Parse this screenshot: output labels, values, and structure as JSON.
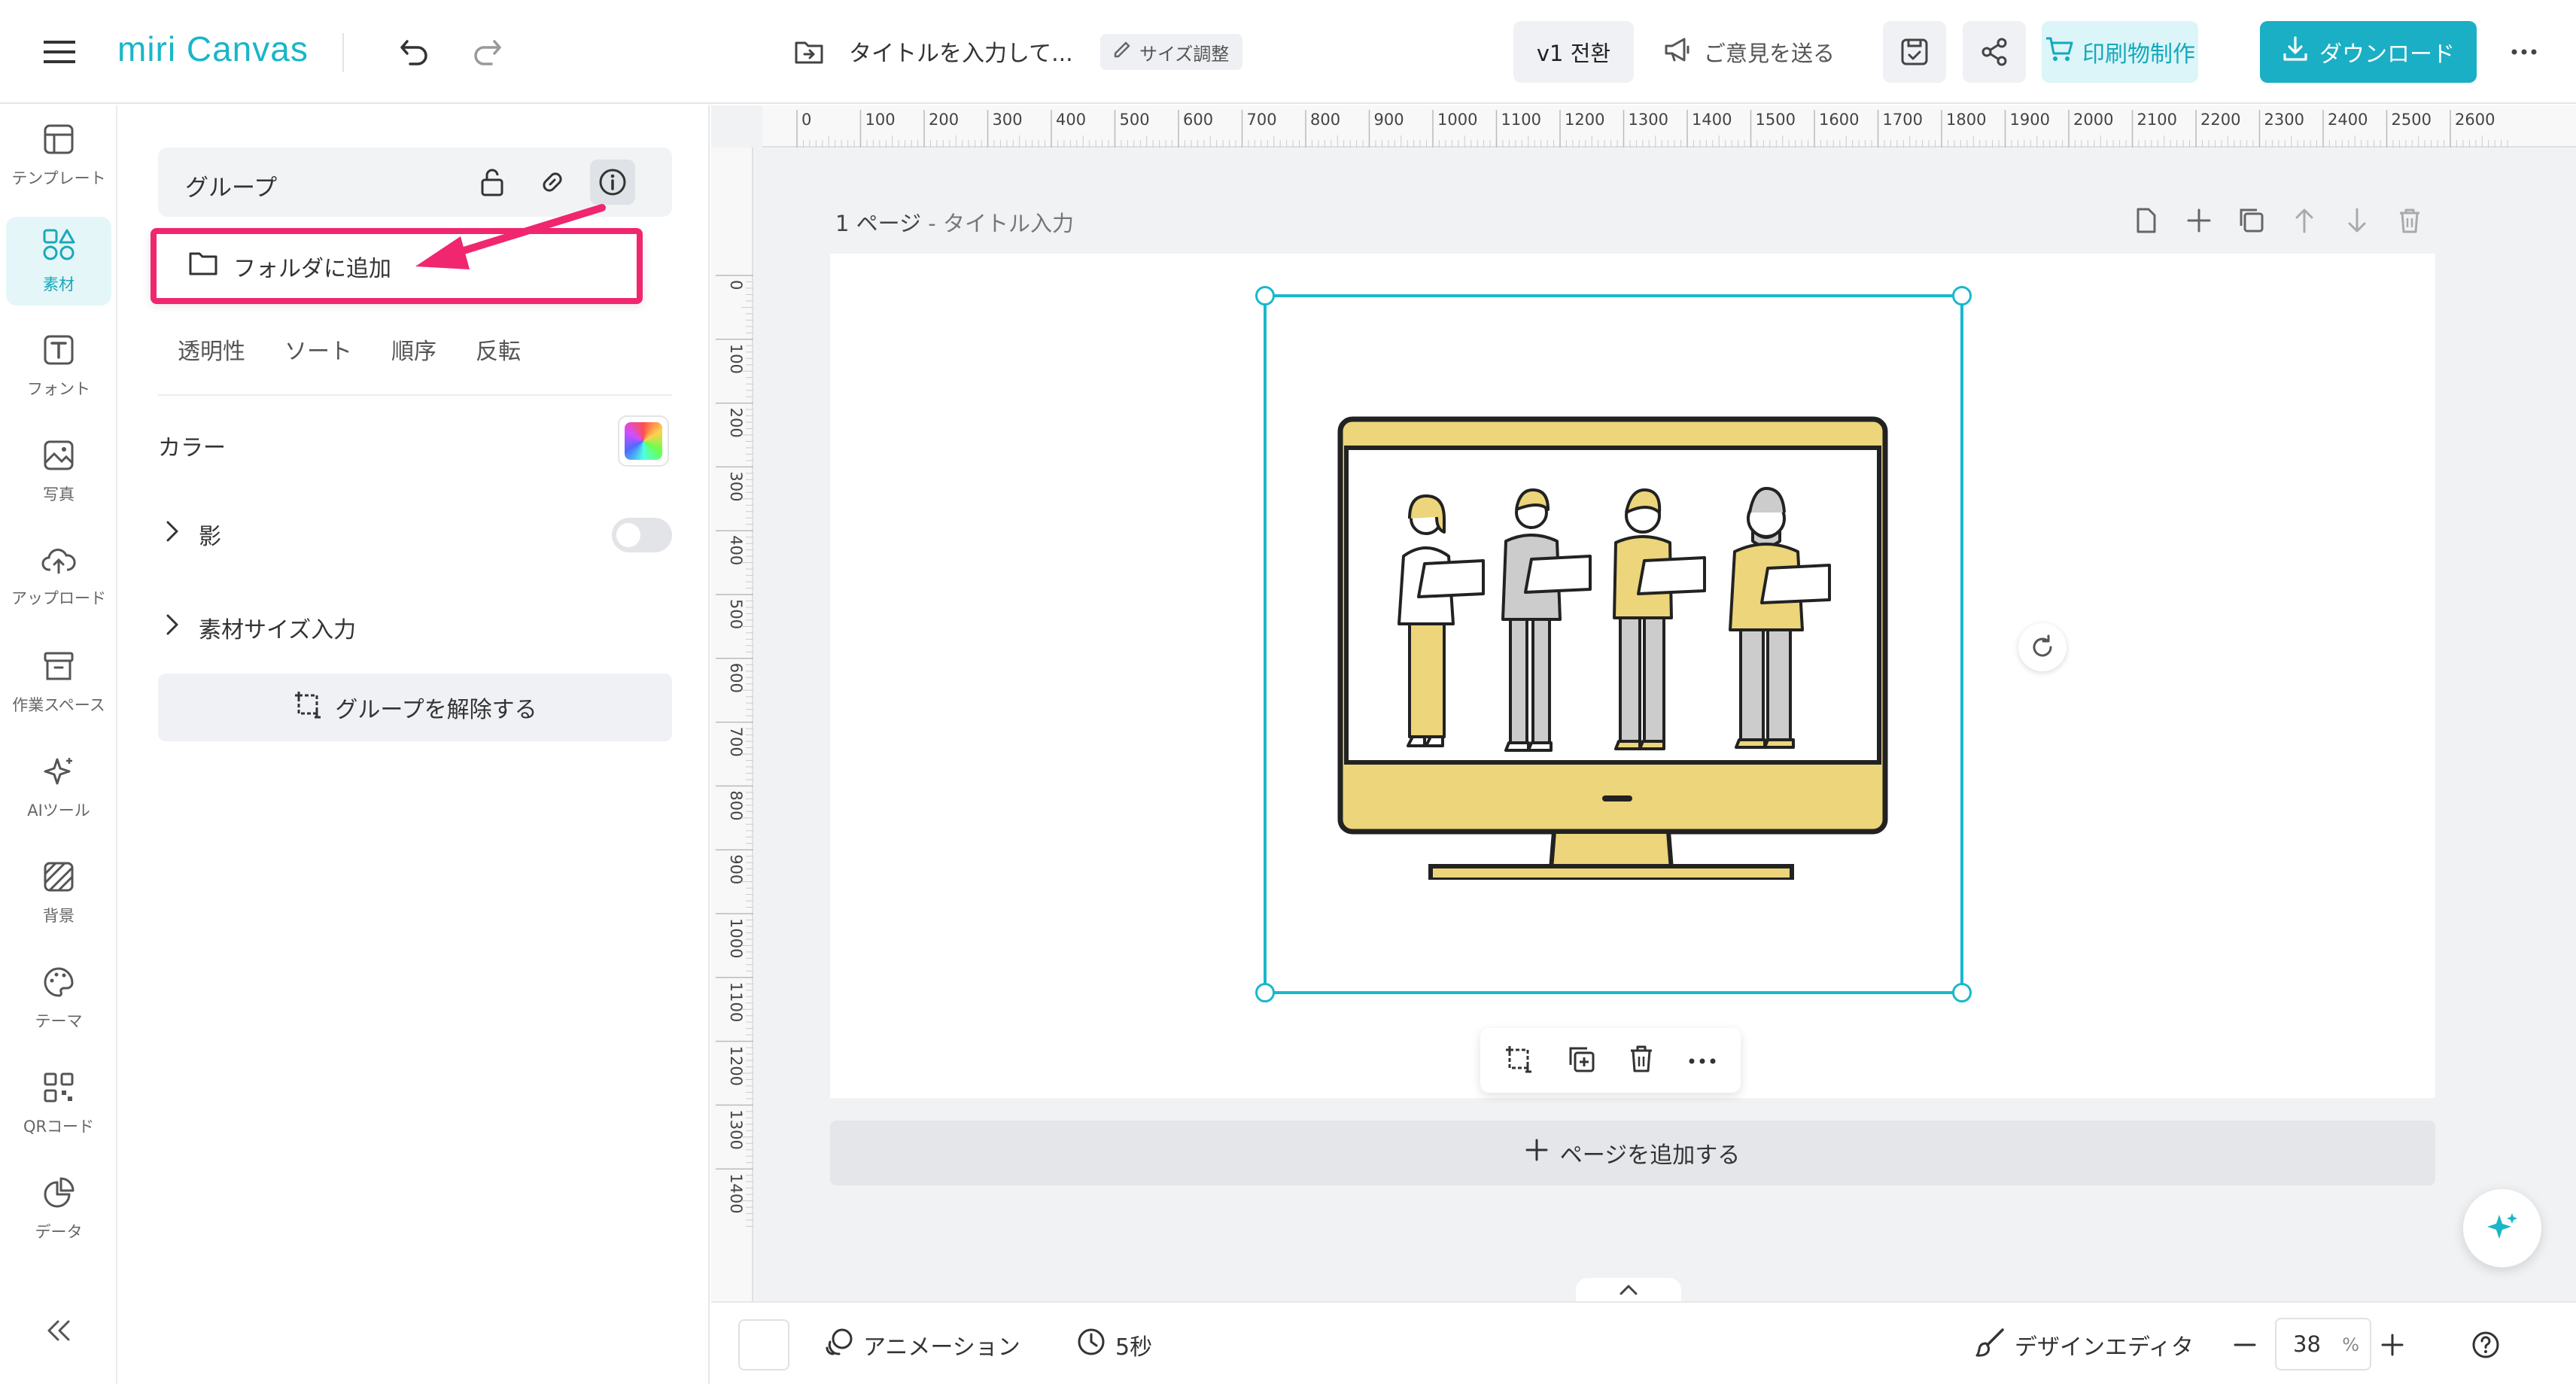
{
  "header": {
    "logo_text": "miri Canvas",
    "doc_title": "タイトルを入力して...",
    "size_chip_label": "サイズ調整",
    "version_label": "v1 전환",
    "feedback_label": "ご意見を送る",
    "print_label": "印刷物制作",
    "download_label": "ダウンロード"
  },
  "rail": {
    "items": [
      {
        "label": "テンプレート",
        "icon": "template-icon"
      },
      {
        "label": "素材",
        "icon": "elements-icon",
        "active": true
      },
      {
        "label": "フォント",
        "icon": "font-icon"
      },
      {
        "label": "写真",
        "icon": "photo-icon"
      },
      {
        "label": "アップロード",
        "icon": "upload-icon"
      },
      {
        "label": "作業スペース",
        "icon": "workspace-icon"
      },
      {
        "label": "AIツール",
        "icon": "ai-sparkle-icon"
      },
      {
        "label": "背景",
        "icon": "background-icon"
      },
      {
        "label": "テーマ",
        "icon": "palette-icon"
      },
      {
        "label": "QRコード",
        "icon": "qr-icon"
      },
      {
        "label": "データ",
        "icon": "chart-icon"
      }
    ]
  },
  "panel": {
    "group_label": "グループ",
    "folder_popup_label": "フォルダに追加",
    "tabs": [
      "透明性",
      "ソート",
      "順序",
      "反転"
    ],
    "color_label": "カラー",
    "shadow_label": "影",
    "shadow_enabled": false,
    "size_label": "素材サイズ入力",
    "ungroup_label": "グループを解除する"
  },
  "workspace": {
    "ruler_top": [
      "0",
      "100",
      "200",
      "300",
      "400",
      "500",
      "600",
      "700",
      "800",
      "900",
      "1000",
      "1100",
      "1200",
      "1300",
      "1400",
      "1500",
      "1600",
      "1700",
      "1800",
      "1900",
      "2000",
      "2100",
      "2200",
      "2300",
      "2400",
      "2500",
      "2600"
    ],
    "ruler_left": [
      "0",
      "100",
      "200",
      "300",
      "400",
      "500",
      "600",
      "700",
      "800",
      "900",
      "1000",
      "1100",
      "1200",
      "1300",
      "1400"
    ],
    "page_number_label": "1 ページ",
    "page_separator": " - ",
    "page_title_placeholder": "タイトル入力",
    "add_page_label": "ページを追加する"
  },
  "bottombar": {
    "animation_label": "アニメーション",
    "duration_label": "5秒",
    "design_editor_label": "デザインエディタ",
    "zoom_value": "38",
    "zoom_unit": "%"
  },
  "colors": {
    "brand": "#19b6c8",
    "highlight": "#f0266f",
    "illustration_yellow": "#ecd57a"
  }
}
